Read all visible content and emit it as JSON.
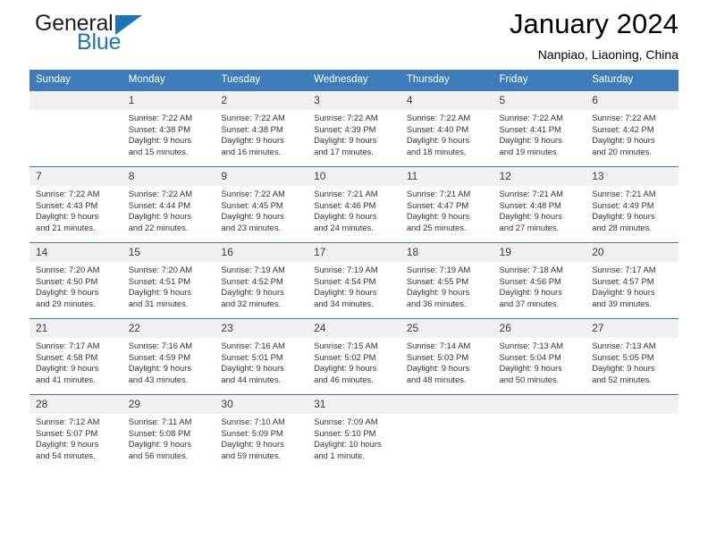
{
  "brand": {
    "name_part1": "General",
    "name_part2": "Blue",
    "flag_icon": "triangle-flag-icon"
  },
  "header": {
    "title": "January 2024",
    "subtitle": "Nanpiao, Liaoning, China"
  },
  "calendar": {
    "accent_color": "#3b7cb9",
    "daynum_band_color": "#f1f1f1",
    "weekday_headers": [
      "Sunday",
      "Monday",
      "Tuesday",
      "Wednesday",
      "Thursday",
      "Friday",
      "Saturday"
    ],
    "weeks": [
      [
        {
          "day": "",
          "sunrise": "",
          "sunset": "",
          "daylight_line1": "",
          "daylight_line2": ""
        },
        {
          "day": "1",
          "sunrise": "Sunrise: 7:22 AM",
          "sunset": "Sunset: 4:38 PM",
          "daylight_line1": "Daylight: 9 hours",
          "daylight_line2": "and 15 minutes."
        },
        {
          "day": "2",
          "sunrise": "Sunrise: 7:22 AM",
          "sunset": "Sunset: 4:38 PM",
          "daylight_line1": "Daylight: 9 hours",
          "daylight_line2": "and 16 minutes."
        },
        {
          "day": "3",
          "sunrise": "Sunrise: 7:22 AM",
          "sunset": "Sunset: 4:39 PM",
          "daylight_line1": "Daylight: 9 hours",
          "daylight_line2": "and 17 minutes."
        },
        {
          "day": "4",
          "sunrise": "Sunrise: 7:22 AM",
          "sunset": "Sunset: 4:40 PM",
          "daylight_line1": "Daylight: 9 hours",
          "daylight_line2": "and 18 minutes."
        },
        {
          "day": "5",
          "sunrise": "Sunrise: 7:22 AM",
          "sunset": "Sunset: 4:41 PM",
          "daylight_line1": "Daylight: 9 hours",
          "daylight_line2": "and 19 minutes."
        },
        {
          "day": "6",
          "sunrise": "Sunrise: 7:22 AM",
          "sunset": "Sunset: 4:42 PM",
          "daylight_line1": "Daylight: 9 hours",
          "daylight_line2": "and 20 minutes."
        }
      ],
      [
        {
          "day": "7",
          "sunrise": "Sunrise: 7:22 AM",
          "sunset": "Sunset: 4:43 PM",
          "daylight_line1": "Daylight: 9 hours",
          "daylight_line2": "and 21 minutes."
        },
        {
          "day": "8",
          "sunrise": "Sunrise: 7:22 AM",
          "sunset": "Sunset: 4:44 PM",
          "daylight_line1": "Daylight: 9 hours",
          "daylight_line2": "and 22 minutes."
        },
        {
          "day": "9",
          "sunrise": "Sunrise: 7:22 AM",
          "sunset": "Sunset: 4:45 PM",
          "daylight_line1": "Daylight: 9 hours",
          "daylight_line2": "and 23 minutes."
        },
        {
          "day": "10",
          "sunrise": "Sunrise: 7:21 AM",
          "sunset": "Sunset: 4:46 PM",
          "daylight_line1": "Daylight: 9 hours",
          "daylight_line2": "and 24 minutes."
        },
        {
          "day": "11",
          "sunrise": "Sunrise: 7:21 AM",
          "sunset": "Sunset: 4:47 PM",
          "daylight_line1": "Daylight: 9 hours",
          "daylight_line2": "and 25 minutes."
        },
        {
          "day": "12",
          "sunrise": "Sunrise: 7:21 AM",
          "sunset": "Sunset: 4:48 PM",
          "daylight_line1": "Daylight: 9 hours",
          "daylight_line2": "and 27 minutes."
        },
        {
          "day": "13",
          "sunrise": "Sunrise: 7:21 AM",
          "sunset": "Sunset: 4:49 PM",
          "daylight_line1": "Daylight: 9 hours",
          "daylight_line2": "and 28 minutes."
        }
      ],
      [
        {
          "day": "14",
          "sunrise": "Sunrise: 7:20 AM",
          "sunset": "Sunset: 4:50 PM",
          "daylight_line1": "Daylight: 9 hours",
          "daylight_line2": "and 29 minutes."
        },
        {
          "day": "15",
          "sunrise": "Sunrise: 7:20 AM",
          "sunset": "Sunset: 4:51 PM",
          "daylight_line1": "Daylight: 9 hours",
          "daylight_line2": "and 31 minutes."
        },
        {
          "day": "16",
          "sunrise": "Sunrise: 7:19 AM",
          "sunset": "Sunset: 4:52 PM",
          "daylight_line1": "Daylight: 9 hours",
          "daylight_line2": "and 32 minutes."
        },
        {
          "day": "17",
          "sunrise": "Sunrise: 7:19 AM",
          "sunset": "Sunset: 4:54 PM",
          "daylight_line1": "Daylight: 9 hours",
          "daylight_line2": "and 34 minutes."
        },
        {
          "day": "18",
          "sunrise": "Sunrise: 7:19 AM",
          "sunset": "Sunset: 4:55 PM",
          "daylight_line1": "Daylight: 9 hours",
          "daylight_line2": "and 36 minutes."
        },
        {
          "day": "19",
          "sunrise": "Sunrise: 7:18 AM",
          "sunset": "Sunset: 4:56 PM",
          "daylight_line1": "Daylight: 9 hours",
          "daylight_line2": "and 37 minutes."
        },
        {
          "day": "20",
          "sunrise": "Sunrise: 7:17 AM",
          "sunset": "Sunset: 4:57 PM",
          "daylight_line1": "Daylight: 9 hours",
          "daylight_line2": "and 39 minutes."
        }
      ],
      [
        {
          "day": "21",
          "sunrise": "Sunrise: 7:17 AM",
          "sunset": "Sunset: 4:58 PM",
          "daylight_line1": "Daylight: 9 hours",
          "daylight_line2": "and 41 minutes."
        },
        {
          "day": "22",
          "sunrise": "Sunrise: 7:16 AM",
          "sunset": "Sunset: 4:59 PM",
          "daylight_line1": "Daylight: 9 hours",
          "daylight_line2": "and 43 minutes."
        },
        {
          "day": "23",
          "sunrise": "Sunrise: 7:16 AM",
          "sunset": "Sunset: 5:01 PM",
          "daylight_line1": "Daylight: 9 hours",
          "daylight_line2": "and 44 minutes."
        },
        {
          "day": "24",
          "sunrise": "Sunrise: 7:15 AM",
          "sunset": "Sunset: 5:02 PM",
          "daylight_line1": "Daylight: 9 hours",
          "daylight_line2": "and 46 minutes."
        },
        {
          "day": "25",
          "sunrise": "Sunrise: 7:14 AM",
          "sunset": "Sunset: 5:03 PM",
          "daylight_line1": "Daylight: 9 hours",
          "daylight_line2": "and 48 minutes."
        },
        {
          "day": "26",
          "sunrise": "Sunrise: 7:13 AM",
          "sunset": "Sunset: 5:04 PM",
          "daylight_line1": "Daylight: 9 hours",
          "daylight_line2": "and 50 minutes."
        },
        {
          "day": "27",
          "sunrise": "Sunrise: 7:13 AM",
          "sunset": "Sunset: 5:05 PM",
          "daylight_line1": "Daylight: 9 hours",
          "daylight_line2": "and 52 minutes."
        }
      ],
      [
        {
          "day": "28",
          "sunrise": "Sunrise: 7:12 AM",
          "sunset": "Sunset: 5:07 PM",
          "daylight_line1": "Daylight: 9 hours",
          "daylight_line2": "and 54 minutes."
        },
        {
          "day": "29",
          "sunrise": "Sunrise: 7:11 AM",
          "sunset": "Sunset: 5:08 PM",
          "daylight_line1": "Daylight: 9 hours",
          "daylight_line2": "and 56 minutes."
        },
        {
          "day": "30",
          "sunrise": "Sunrise: 7:10 AM",
          "sunset": "Sunset: 5:09 PM",
          "daylight_line1": "Daylight: 9 hours",
          "daylight_line2": "and 59 minutes."
        },
        {
          "day": "31",
          "sunrise": "Sunrise: 7:09 AM",
          "sunset": "Sunset: 5:10 PM",
          "daylight_line1": "Daylight: 10 hours",
          "daylight_line2": "and 1 minute."
        },
        {
          "day": "",
          "sunrise": "",
          "sunset": "",
          "daylight_line1": "",
          "daylight_line2": ""
        },
        {
          "day": "",
          "sunrise": "",
          "sunset": "",
          "daylight_line1": "",
          "daylight_line2": ""
        },
        {
          "day": "",
          "sunrise": "",
          "sunset": "",
          "daylight_line1": "",
          "daylight_line2": ""
        }
      ]
    ]
  }
}
